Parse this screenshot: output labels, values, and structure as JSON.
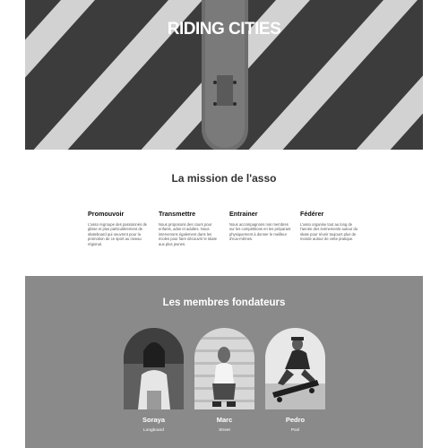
{
  "hero": {
    "title": "RIDING CITIES",
    "image": "skateboard-on-crosswalk-photo"
  },
  "mission": {
    "title": "La mission de l'asso",
    "columns": [
      {
        "title": "Promouvoir",
        "text": "L'asso regroupe des passionnés de glisse et plus particulièrement de skateboard qui oeuvrent pour la promotion de ce sport au niveau régional."
      },
      {
        "title": "Transmettre",
        "text": "Nous proposons des cours pour enfants, ados et adultes. Nous intervenons également dans les écoles pour faire découvrir le skate aux plus jeunes."
      },
      {
        "title": "Entrainer",
        "text": "Nous accompagnons nos membres sur les compétitions en les préparant physiquement à donner le meilleur d'eux-mêmes."
      },
      {
        "title": "Fédérer",
        "text": "L'asso organise tout au long de l'année des évènements autour du skate pour réunir toujours plus de monde autour de cette pratique."
      }
    ]
  },
  "founders": {
    "title": "Les membres fondateurs",
    "members": [
      {
        "name": "Soraya",
        "style": "Longboard"
      },
      {
        "name": "Marc",
        "style": "Street"
      },
      {
        "name": "Pedro",
        "style": "Pool"
      }
    ]
  },
  "colors": {
    "founders_bg": "#8a8a8a",
    "hero_text": "#ffffff"
  }
}
